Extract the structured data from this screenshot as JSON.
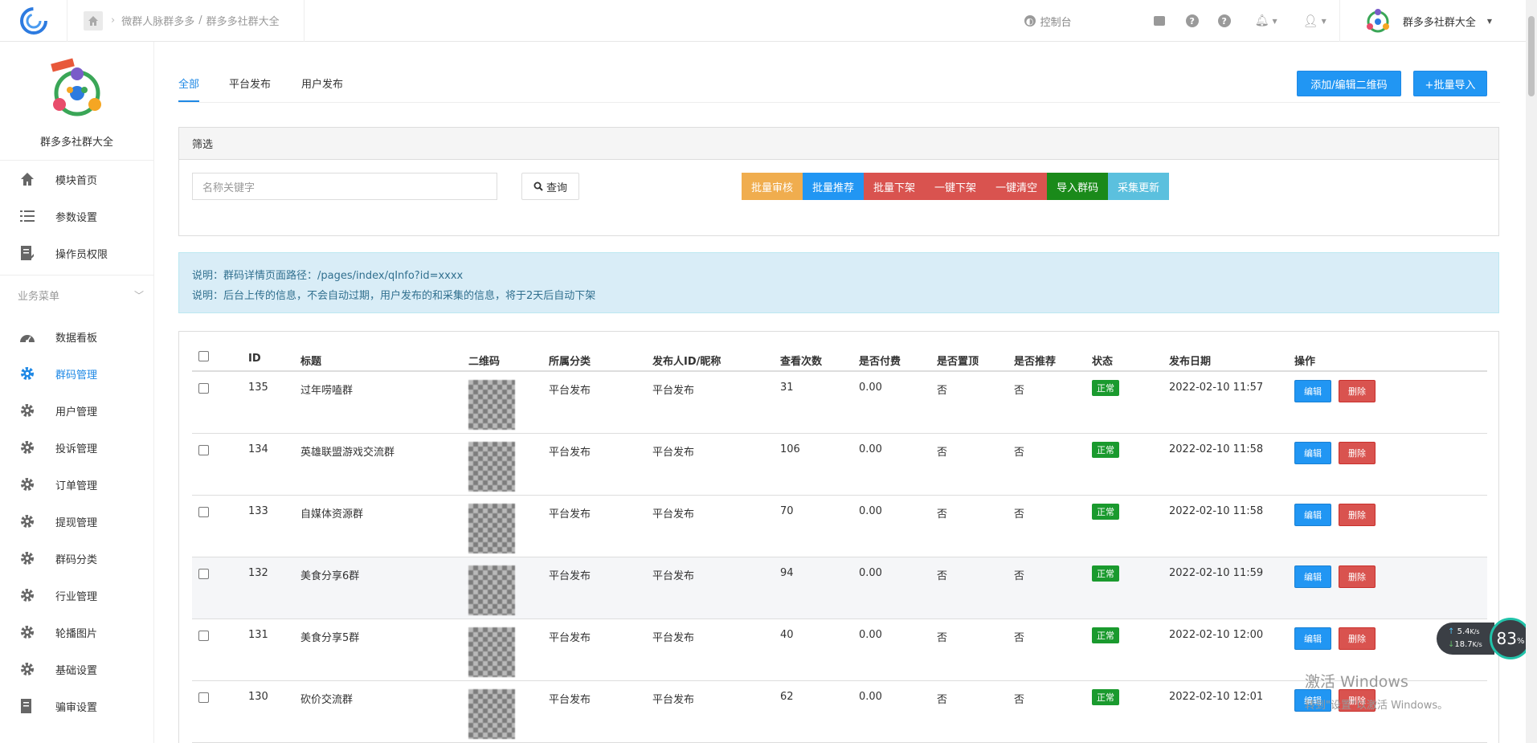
{
  "topbar": {
    "breadcrumb": [
      "微群人脉群多多",
      "群多多社群大全"
    ],
    "console_label": "控制台",
    "brand_name": "群多多社群大全"
  },
  "sidebar": {
    "app_name": "群多多社群大全",
    "top_items": [
      {
        "label": "模块首页",
        "icon": "home-icon"
      },
      {
        "label": "参数设置",
        "icon": "list-icon"
      },
      {
        "label": "操作员权限",
        "icon": "edit-doc-icon"
      }
    ],
    "group_label": "业务菜单",
    "items": [
      {
        "label": "数据看板",
        "icon": "dashboard-icon"
      },
      {
        "label": "群码管理",
        "icon": "gear-icon",
        "active": true
      },
      {
        "label": "用户管理",
        "icon": "gear-icon"
      },
      {
        "label": "投诉管理",
        "icon": "gear-icon"
      },
      {
        "label": "订单管理",
        "icon": "gear-icon"
      },
      {
        "label": "提现管理",
        "icon": "gear-icon"
      },
      {
        "label": "群码分类",
        "icon": "gear-icon"
      },
      {
        "label": "行业管理",
        "icon": "gear-icon"
      },
      {
        "label": "轮播图片",
        "icon": "gear-icon"
      },
      {
        "label": "基础设置",
        "icon": "gear-icon"
      },
      {
        "label": "骗审设置",
        "icon": "edit-doc-icon"
      }
    ]
  },
  "tabs": [
    "全部",
    "平台发布",
    "用户发布"
  ],
  "buttons": {
    "add_edit": "添加/编辑二维码",
    "batch_import": "+批量导入"
  },
  "filter": {
    "title": "筛选",
    "placeholder": "名称关键字",
    "search_label": "查询",
    "actions": [
      {
        "label": "批量审核",
        "color": "#f0ad4e"
      },
      {
        "label": "批量推荐",
        "color": "#2196f3"
      },
      {
        "label": "批量下架",
        "color": "#d9534f"
      },
      {
        "label": "一键下架",
        "color": "#d9534f"
      },
      {
        "label": "一键清空",
        "color": "#d9534f"
      },
      {
        "label": "导入群码",
        "color": "#1a8a1a"
      },
      {
        "label": "采集更新",
        "color": "#5bc0de"
      }
    ]
  },
  "notice": {
    "line1": "说明：群码详情页面路径：/pages/index/qInfo?id=xxxx",
    "line2": "说明：后台上传的信息，不会自动过期，用户发布的和采集的信息，将于2天后自动下架"
  },
  "table": {
    "headers": [
      "ID",
      "标题",
      "二维码",
      "所属分类",
      "发布人ID/昵称",
      "查看次数",
      "是否付费",
      "是否置顶",
      "是否推荐",
      "状态",
      "发布日期",
      "操作"
    ],
    "edit_label": "编辑",
    "delete_label": "删除",
    "rows": [
      {
        "id": "135",
        "title": "过年唠嗑群",
        "category": "平台发布",
        "publisher": "平台发布",
        "views": "31",
        "paid": "0.00",
        "top": "否",
        "recommend": "否",
        "status": "正常",
        "date": "2022-02-10 11:57"
      },
      {
        "id": "134",
        "title": "英雄联盟游戏交流群",
        "category": "平台发布",
        "publisher": "平台发布",
        "views": "106",
        "paid": "0.00",
        "top": "否",
        "recommend": "否",
        "status": "正常",
        "date": "2022-02-10 11:58"
      },
      {
        "id": "133",
        "title": "自媒体资源群",
        "category": "平台发布",
        "publisher": "平台发布",
        "views": "70",
        "paid": "0.00",
        "top": "否",
        "recommend": "否",
        "status": "正常",
        "date": "2022-02-10 11:58"
      },
      {
        "id": "132",
        "title": "美食分享6群",
        "category": "平台发布",
        "publisher": "平台发布",
        "views": "94",
        "paid": "0.00",
        "top": "否",
        "recommend": "否",
        "status": "正常",
        "date": "2022-02-10 11:59"
      },
      {
        "id": "131",
        "title": "美食分享5群",
        "category": "平台发布",
        "publisher": "平台发布",
        "views": "40",
        "paid": "0.00",
        "top": "否",
        "recommend": "否",
        "status": "正常",
        "date": "2022-02-10 12:00"
      },
      {
        "id": "130",
        "title": "砍价交流群",
        "category": "平台发布",
        "publisher": "平台发布",
        "views": "62",
        "paid": "0.00",
        "top": "否",
        "recommend": "否",
        "status": "正常",
        "date": "2022-02-10 12:01"
      }
    ]
  },
  "overlay": {
    "up_speed": "5.4",
    "down_speed": "18.7",
    "speed_unit": "K/s",
    "percent": "83",
    "percent_unit": "%",
    "watermark_l1": "激活 Windows",
    "watermark_l2": "转到\"设置\"以激活 Windows。"
  }
}
